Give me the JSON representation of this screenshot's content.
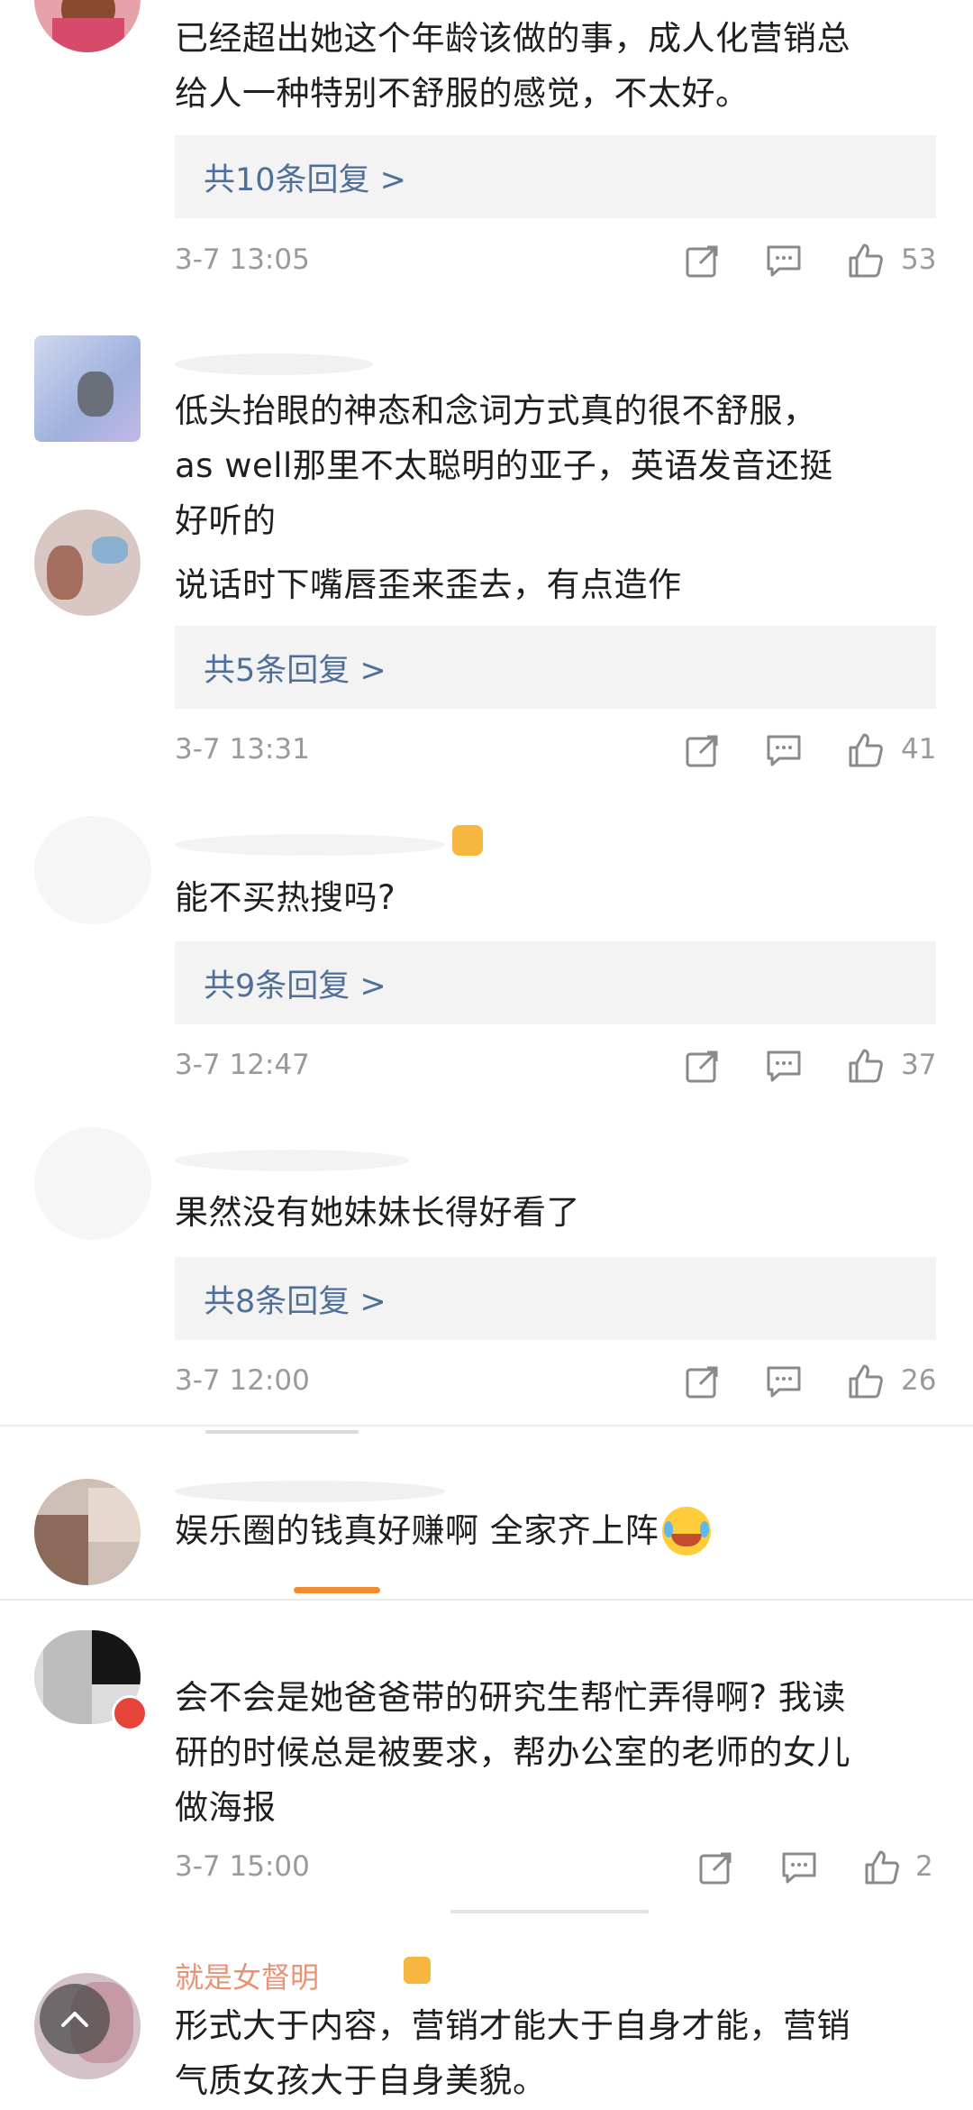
{
  "comments": [
    {
      "text_lines": [
        "已经超出她这个年龄该做的事，成人化营销总",
        "给人一种特别不舒服的感觉，不太好。"
      ],
      "replies_label": "共10条回复 >",
      "time": "3-7 13:05",
      "likes": "53"
    },
    {
      "text_lines": [
        "低头抬眼的神态和念词方式真的很不舒服，",
        "as well那里不太聪明的亚子，英语发音还挺",
        "好听的"
      ],
      "likes": ""
    },
    {
      "text_lines": [
        "说话时下嘴唇歪来歪去，有点造作"
      ],
      "replies_label": "共5条回复 >",
      "time": "3-7 13:31",
      "likes": "41"
    },
    {
      "text_lines": [
        "能不买热搜吗?"
      ],
      "replies_label": "共9条回复 >",
      "time": "3-7 12:47",
      "likes": "37"
    },
    {
      "text_lines": [
        "果然没有她妹妹长得好看了"
      ],
      "replies_label": "共8条回复 >",
      "time": "3-7 12:00",
      "likes": "26"
    },
    {
      "text_lines": [
        "娱乐圈的钱真好赚啊 全家齐上阵"
      ]
    },
    {
      "text_lines": [
        "会不会是她爸爸带的研究生帮忙弄得啊? 我读",
        "研的时候总是被要求，帮办公室的老师的女儿",
        "做海报"
      ],
      "time": "3-7 15:00",
      "likes": "2"
    },
    {
      "username": "就是女督明",
      "text_lines": [
        "形式大于内容，营销才能大于自身才能，营销",
        "气质女孩大于自身美貌。"
      ]
    }
  ],
  "icons": {
    "share": "share-icon",
    "comment": "comment-icon",
    "like": "thumbs-up-icon",
    "emoji": "crying-laugh-emoji-icon",
    "scroll_top": "chevron-up-icon"
  },
  "colors": {
    "reply_link": "#4f6f98",
    "meta_gray": "#9a9a9a",
    "accent_orange": "#f08c30"
  }
}
